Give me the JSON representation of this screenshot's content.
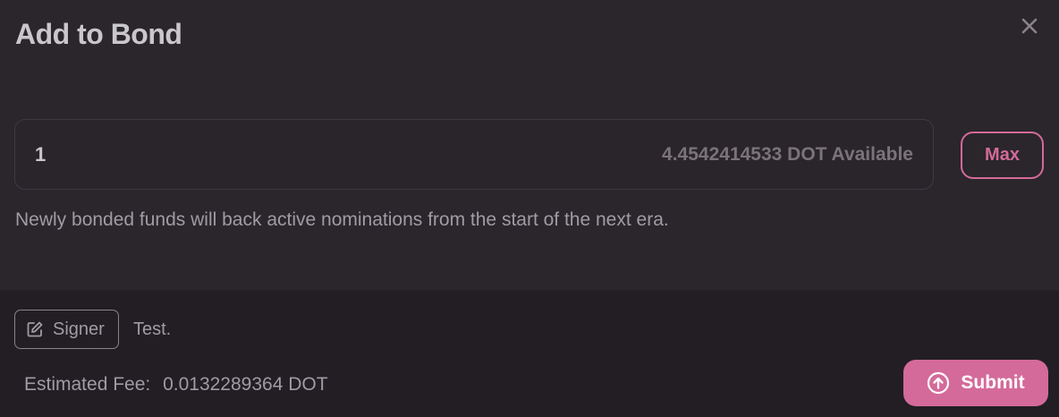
{
  "modal": {
    "title": "Add to Bond"
  },
  "bond": {
    "amount_value": "1",
    "available_text": "4.4542414533 DOT Available",
    "max_label": "Max",
    "note": "Newly bonded funds will back active nominations from the start of the next era."
  },
  "footer": {
    "signer_label": "Signer",
    "signer_name": "Test.",
    "fee_label": "Estimated Fee:",
    "fee_value": "0.0132289364 DOT",
    "submit_label": "Submit"
  },
  "icons": {
    "close": "close-icon",
    "signer": "edit-icon",
    "submit": "arrow-up-circle-icon"
  },
  "colors": {
    "background": "#2a262c",
    "footer_background": "#221e24",
    "accent": "#d46a9a",
    "title": "#c9c6cc",
    "muted_text": "#a19ba3"
  }
}
